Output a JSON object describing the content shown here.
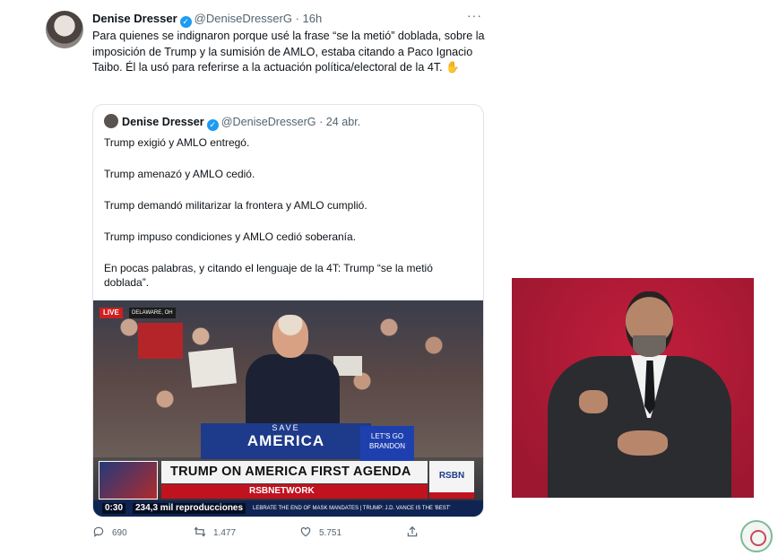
{
  "tweet": {
    "author_name": "Denise Dresser",
    "handle": "@DeniseDresserG",
    "separator": "·",
    "time": "16h",
    "more_label": "···",
    "text": "Para quienes se indignaron porque usé la frase “se la metió” doblada, sobre la imposición de Trump y la sumisión de AMLO, estaba citando a Paco Ignacio Taibo. Él la usó para referirse a la actuación política/electoral de la 4T. ✋"
  },
  "quote": {
    "author_name": "Denise Dresser",
    "handle": "@DeniseDresserG",
    "separator": "·",
    "date": "24 abr.",
    "paragraphs": [
      "Trump exigió y AMLO entregó.",
      "Trump amenazó y AMLO cedió.",
      "Trump demandó militarizar la frontera y  AMLO cumplió.",
      "Trump impuso condiciones y AMLO cedió soberanía.",
      "En pocas palabras, y citando el lenguaje de la 4T: Trump “se la metió doblada”."
    ]
  },
  "video": {
    "live_badge": "LIVE",
    "location": "DELAWARE, OH",
    "podium_small": "SAVE",
    "podium_big": "AMERICA",
    "sign_text": "LET'S GO BRANDON",
    "headline": "TRUMP ON AMERICA FIRST AGENDA",
    "channel": "RSBNETWORK",
    "logo": "RSBN",
    "ticker": "LEBRATE THE END OF MASK MANDATES  |  TRUMP: J.D. VANCE IS THE 'BEST'",
    "timecode": "0:30",
    "views": "234,3 mil reproducciones"
  },
  "actions": {
    "replies": "690",
    "retweets": "1.477",
    "likes": "5.751"
  },
  "colors": {
    "verified": "#1d9bf0",
    "interpreter_bg": "#b01a35",
    "headline_bar": "#c1121f"
  }
}
